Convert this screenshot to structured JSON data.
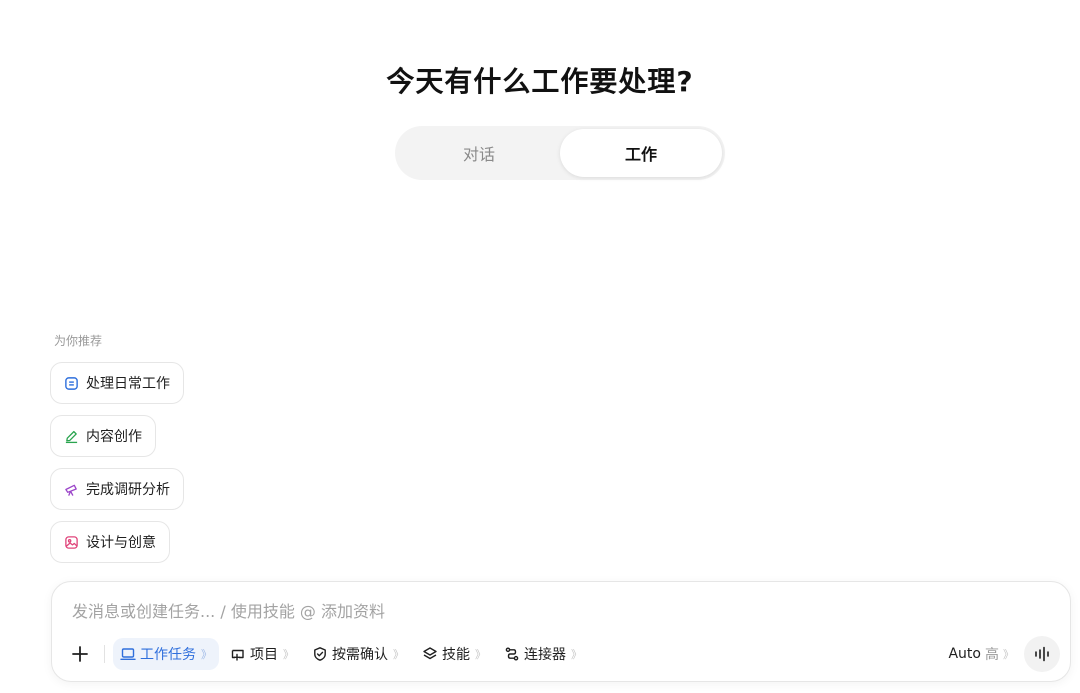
{
  "heading": "今天有什么工作要处理?",
  "mode_tabs": [
    {
      "label": "对话",
      "active": false
    },
    {
      "label": "工作",
      "active": true
    }
  ],
  "recommend": {
    "label": "为你推荐",
    "items": [
      {
        "label": "处理日常工作",
        "icon": "calendar-icon",
        "color": "#2f6fdc"
      },
      {
        "label": "内容创作",
        "icon": "pen-icon",
        "color": "#2aa44f"
      },
      {
        "label": "完成调研分析",
        "icon": "telescope-icon",
        "color": "#9b45c9"
      },
      {
        "label": "设计与创意",
        "icon": "image-icon",
        "color": "#e0457b"
      }
    ]
  },
  "composer": {
    "placeholder": "发消息或创建任务... / 使用技能 @ 添加资料",
    "tools": [
      {
        "label": "工作任务",
        "icon": "laptop-icon",
        "active": true
      },
      {
        "label": "项目",
        "icon": "project-icon",
        "active": false
      },
      {
        "label": "按需确认",
        "icon": "check-circle-icon",
        "active": false
      },
      {
        "label": "技能",
        "icon": "layers-icon",
        "active": false
      },
      {
        "label": "连接器",
        "icon": "connector-icon",
        "active": false
      }
    ],
    "chevron": "》",
    "model": {
      "label": "Auto",
      "level": "高"
    }
  },
  "colors": {
    "accent": "#2f6fdc",
    "active_bg": "#eef3fb"
  }
}
